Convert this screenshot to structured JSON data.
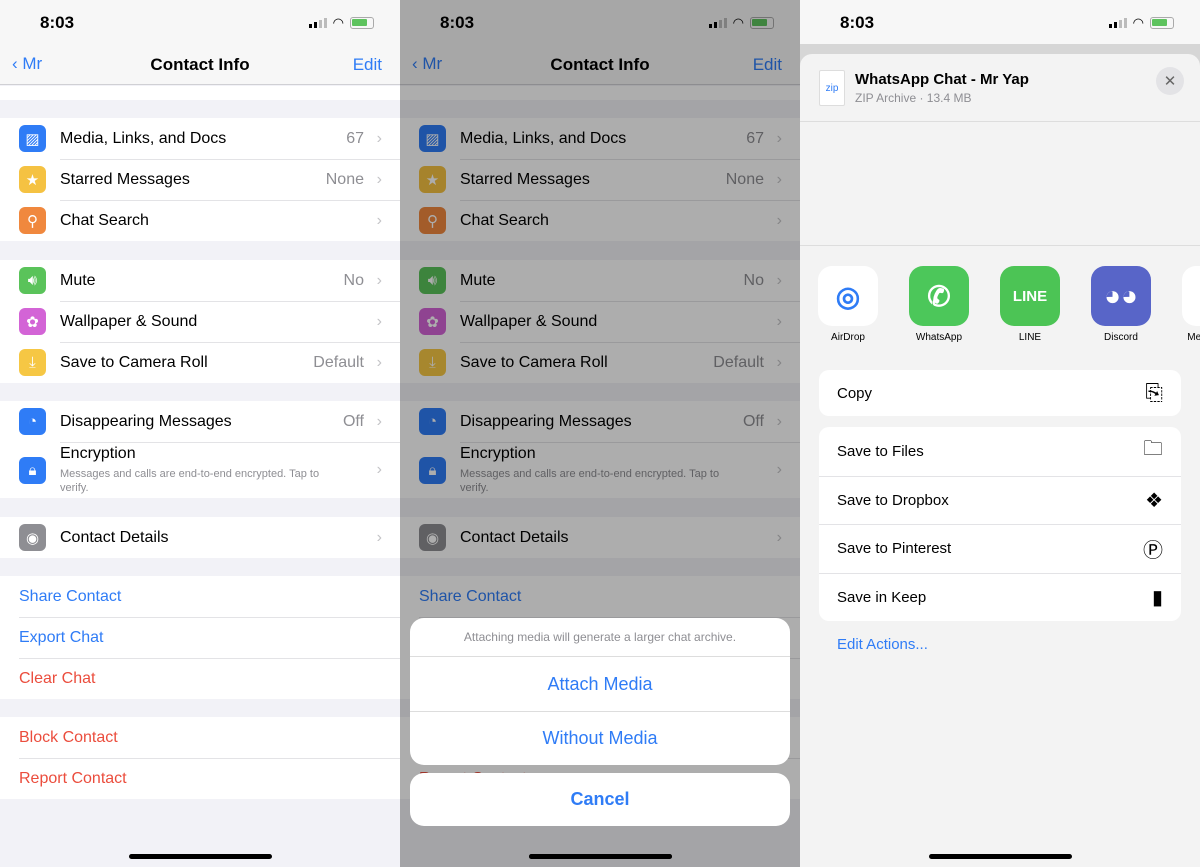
{
  "status": {
    "time": "8:03"
  },
  "nav": {
    "back": "Mr",
    "title": "Contact Info",
    "edit": "Edit"
  },
  "groups": [
    [
      {
        "label": "Media, Links, and Docs",
        "value": "67",
        "icon": "photo-icon",
        "color": "#2f7cf6",
        "glyph": "▨"
      },
      {
        "label": "Starred Messages",
        "value": "None",
        "icon": "star-icon",
        "color": "#f5c242",
        "glyph": "★"
      },
      {
        "label": "Chat Search",
        "value": "",
        "icon": "search-icon",
        "color": "#f0883e",
        "glyph": "⚲"
      }
    ],
    [
      {
        "label": "Mute",
        "value": "No",
        "icon": "speaker-icon",
        "color": "#5ac35a",
        "glyph": "🔊︎"
      },
      {
        "label": "Wallpaper & Sound",
        "value": "",
        "icon": "flower-icon",
        "color": "#d364d6",
        "glyph": "✿"
      },
      {
        "label": "Save to Camera Roll",
        "value": "Default",
        "icon": "download-icon",
        "color": "#f6c744",
        "glyph": "⤓"
      }
    ],
    [
      {
        "label": "Disappearing Messages",
        "value": "Off",
        "icon": "timer-icon",
        "color": "#2f7cf6",
        "glyph": "◔"
      },
      {
        "label": "Encryption",
        "sub": "Messages and calls are end-to-end encrypted. Tap to verify.",
        "value": "",
        "icon": "lock-icon",
        "color": "#2f7cf6",
        "glyph": "🔒︎"
      }
    ],
    [
      {
        "label": "Contact Details",
        "value": "",
        "icon": "person-icon",
        "color": "#8e8e93",
        "glyph": "◉"
      }
    ]
  ],
  "actions": [
    [
      {
        "label": "Share Contact",
        "color": "#2f7cf6"
      },
      {
        "label": "Export Chat",
        "color": "#2f7cf6"
      },
      {
        "label": "Clear Chat",
        "color": "#eb4d3d"
      }
    ],
    [
      {
        "label": "Block Contact",
        "color": "#eb4d3d"
      },
      {
        "label": "Report Contact",
        "color": "#eb4d3d"
      }
    ]
  ],
  "action_sheet": {
    "message": "Attaching media will generate a larger chat archive.",
    "attach": "Attach Media",
    "without": "Without Media",
    "cancel": "Cancel"
  },
  "share": {
    "file_icon": "zip",
    "file_name": "WhatsApp Chat - Mr Yap",
    "file_meta": "ZIP Archive · 13.4 MB",
    "apps": [
      {
        "name": "AirDrop",
        "bg": "#ffffff",
        "fg": "#2f7cf6",
        "glyph": "◎"
      },
      {
        "name": "WhatsApp",
        "bg": "#4cc75a",
        "fg": "#ffffff",
        "glyph": "✆"
      },
      {
        "name": "LINE",
        "bg": "#4cc455",
        "fg": "#ffffff",
        "glyph": "LINE"
      },
      {
        "name": "Discord",
        "bg": "#5865c8",
        "fg": "#ffffff",
        "glyph": "◕◕"
      },
      {
        "name": "Messenger",
        "bg": "#ffffff",
        "fg": "#a040f0",
        "glyph": "◐"
      }
    ],
    "copy": {
      "label": "Copy",
      "icon": "copy-icon",
      "glyph": "⎘"
    },
    "list": [
      {
        "label": "Save to Files",
        "icon": "folder-icon",
        "glyph": "🗀"
      },
      {
        "label": "Save to Dropbox",
        "icon": "dropbox-icon",
        "glyph": "❖"
      },
      {
        "label": "Save to Pinterest",
        "icon": "pinterest-icon",
        "glyph": "Ⓟ"
      },
      {
        "label": "Save in Keep",
        "icon": "bookmark-icon",
        "glyph": "▮"
      }
    ],
    "edit_actions": "Edit Actions..."
  }
}
